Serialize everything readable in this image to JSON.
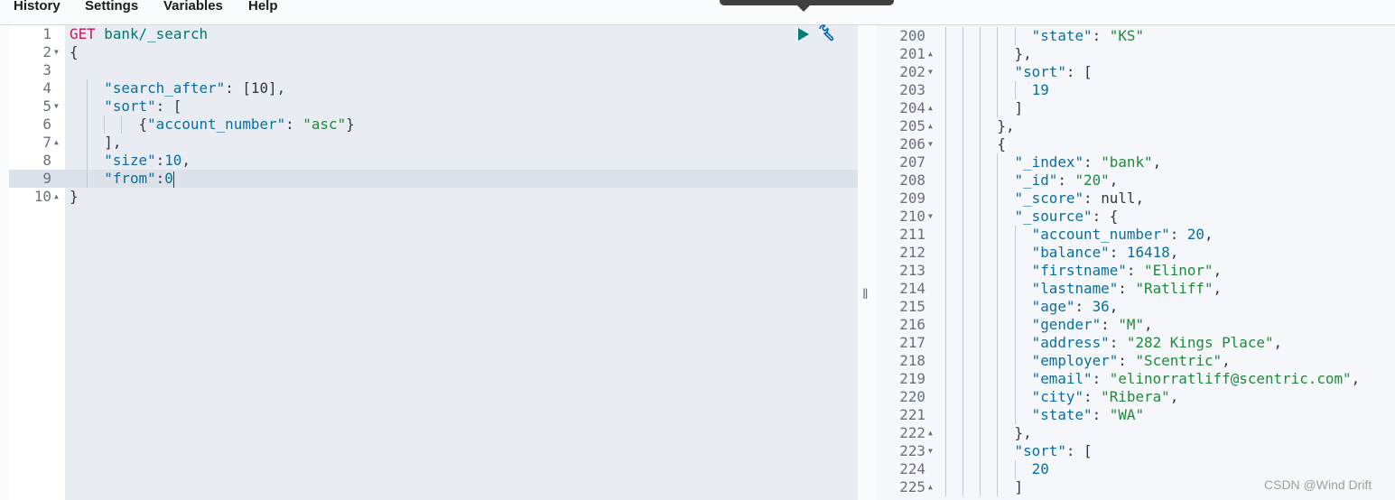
{
  "menu": {
    "items": [
      "History",
      "Settings",
      "Variables",
      "Help"
    ]
  },
  "colors": {
    "method": "#c2185b",
    "url": "#00766c",
    "key": "#0b6ea0",
    "string": "#1f8a3a",
    "run": "#017d73",
    "wrench": "#006bb8"
  },
  "request": {
    "run_icon": "play-icon",
    "settings_icon": "wrench-icon",
    "active_line": 9,
    "lines": [
      {
        "n": "1",
        "fold": "",
        "ind": 0,
        "t": [
          [
            "method",
            "GET"
          ],
          [
            "punc",
            " "
          ],
          [
            "url",
            "bank/_search"
          ]
        ]
      },
      {
        "n": "2",
        "fold": "down",
        "ind": 0,
        "t": [
          [
            "punc",
            "{"
          ]
        ]
      },
      {
        "n": "3",
        "fold": "",
        "ind": 0,
        "t": []
      },
      {
        "n": "4",
        "fold": "",
        "ind": 2,
        "t": [
          [
            "key",
            "\"search_after\""
          ],
          [
            "punc",
            ": [10],"
          ]
        ]
      },
      {
        "n": "5",
        "fold": "down",
        "ind": 2,
        "t": [
          [
            "key",
            "\"sort\""
          ],
          [
            "punc",
            ": ["
          ]
        ]
      },
      {
        "n": "6",
        "fold": "",
        "ind": 4,
        "t": [
          [
            "punc",
            "{"
          ],
          [
            "key",
            "\"account_number\""
          ],
          [
            "punc",
            ": "
          ],
          [
            "str",
            "\"asc\""
          ],
          [
            "punc",
            "}"
          ]
        ]
      },
      {
        "n": "7",
        "fold": "up",
        "ind": 2,
        "t": [
          [
            "punc",
            "],"
          ]
        ]
      },
      {
        "n": "8",
        "fold": "",
        "ind": 2,
        "t": [
          [
            "key",
            "\"size\""
          ],
          [
            "punc",
            ":"
          ],
          [
            "num",
            "10"
          ],
          [
            "punc",
            ","
          ]
        ]
      },
      {
        "n": "9",
        "fold": "",
        "ind": 2,
        "t": [
          [
            "key",
            "\"from\""
          ],
          [
            "punc",
            ":"
          ],
          [
            "num",
            "0"
          ]
        ]
      },
      {
        "n": "10",
        "fold": "up",
        "ind": 0,
        "t": [
          [
            "punc",
            "}"
          ]
        ]
      }
    ]
  },
  "response": {
    "lines": [
      {
        "n": "200",
        "fold": "",
        "ind": 5,
        "t": [
          [
            "key",
            "\"state\""
          ],
          [
            "punc",
            ": "
          ],
          [
            "str",
            "\"KS\""
          ]
        ]
      },
      {
        "n": "201",
        "fold": "up",
        "ind": 4,
        "t": [
          [
            "punc",
            "},"
          ]
        ]
      },
      {
        "n": "202",
        "fold": "down",
        "ind": 4,
        "t": [
          [
            "key",
            "\"sort\""
          ],
          [
            "punc",
            ": ["
          ]
        ]
      },
      {
        "n": "203",
        "fold": "",
        "ind": 5,
        "t": [
          [
            "num",
            "19"
          ]
        ]
      },
      {
        "n": "204",
        "fold": "up",
        "ind": 4,
        "t": [
          [
            "punc",
            "]"
          ]
        ]
      },
      {
        "n": "205",
        "fold": "up",
        "ind": 3,
        "t": [
          [
            "punc",
            "},"
          ]
        ]
      },
      {
        "n": "206",
        "fold": "down",
        "ind": 3,
        "t": [
          [
            "punc",
            "{"
          ]
        ]
      },
      {
        "n": "207",
        "fold": "",
        "ind": 4,
        "t": [
          [
            "key",
            "\"_index\""
          ],
          [
            "punc",
            ": "
          ],
          [
            "str",
            "\"bank\""
          ],
          [
            "punc",
            ","
          ]
        ]
      },
      {
        "n": "208",
        "fold": "",
        "ind": 4,
        "t": [
          [
            "key",
            "\"_id\""
          ],
          [
            "punc",
            ": "
          ],
          [
            "str",
            "\"20\""
          ],
          [
            "punc",
            ","
          ]
        ]
      },
      {
        "n": "209",
        "fold": "",
        "ind": 4,
        "t": [
          [
            "key",
            "\"_score\""
          ],
          [
            "punc",
            ": "
          ],
          [
            "null",
            "null"
          ],
          [
            "punc",
            ","
          ]
        ]
      },
      {
        "n": "210",
        "fold": "down",
        "ind": 4,
        "t": [
          [
            "key",
            "\"_source\""
          ],
          [
            "punc",
            ": {"
          ]
        ]
      },
      {
        "n": "211",
        "fold": "",
        "ind": 5,
        "t": [
          [
            "key",
            "\"account_number\""
          ],
          [
            "punc",
            ": "
          ],
          [
            "num",
            "20"
          ],
          [
            "punc",
            ","
          ]
        ]
      },
      {
        "n": "212",
        "fold": "",
        "ind": 5,
        "t": [
          [
            "key",
            "\"balance\""
          ],
          [
            "punc",
            ": "
          ],
          [
            "num",
            "16418"
          ],
          [
            "punc",
            ","
          ]
        ]
      },
      {
        "n": "213",
        "fold": "",
        "ind": 5,
        "t": [
          [
            "key",
            "\"firstname\""
          ],
          [
            "punc",
            ": "
          ],
          [
            "str",
            "\"Elinor\""
          ],
          [
            "punc",
            ","
          ]
        ]
      },
      {
        "n": "214",
        "fold": "",
        "ind": 5,
        "t": [
          [
            "key",
            "\"lastname\""
          ],
          [
            "punc",
            ": "
          ],
          [
            "str",
            "\"Ratliff\""
          ],
          [
            "punc",
            ","
          ]
        ]
      },
      {
        "n": "215",
        "fold": "",
        "ind": 5,
        "t": [
          [
            "key",
            "\"age\""
          ],
          [
            "punc",
            ": "
          ],
          [
            "num",
            "36"
          ],
          [
            "punc",
            ","
          ]
        ]
      },
      {
        "n": "216",
        "fold": "",
        "ind": 5,
        "t": [
          [
            "key",
            "\"gender\""
          ],
          [
            "punc",
            ": "
          ],
          [
            "str",
            "\"M\""
          ],
          [
            "punc",
            ","
          ]
        ]
      },
      {
        "n": "217",
        "fold": "",
        "ind": 5,
        "t": [
          [
            "key",
            "\"address\""
          ],
          [
            "punc",
            ": "
          ],
          [
            "str",
            "\"282 Kings Place\""
          ],
          [
            "punc",
            ","
          ]
        ]
      },
      {
        "n": "218",
        "fold": "",
        "ind": 5,
        "t": [
          [
            "key",
            "\"employer\""
          ],
          [
            "punc",
            ": "
          ],
          [
            "str",
            "\"Scentric\""
          ],
          [
            "punc",
            ","
          ]
        ]
      },
      {
        "n": "219",
        "fold": "",
        "ind": 5,
        "t": [
          [
            "key",
            "\"email\""
          ],
          [
            "punc",
            ": "
          ],
          [
            "str",
            "\"elinorratliff@scentric.com\""
          ],
          [
            "punc",
            ","
          ]
        ]
      },
      {
        "n": "220",
        "fold": "",
        "ind": 5,
        "t": [
          [
            "key",
            "\"city\""
          ],
          [
            "punc",
            ": "
          ],
          [
            "str",
            "\"Ribera\""
          ],
          [
            "punc",
            ","
          ]
        ]
      },
      {
        "n": "221",
        "fold": "",
        "ind": 5,
        "t": [
          [
            "key",
            "\"state\""
          ],
          [
            "punc",
            ": "
          ],
          [
            "str",
            "\"WA\""
          ]
        ]
      },
      {
        "n": "222",
        "fold": "up",
        "ind": 4,
        "t": [
          [
            "punc",
            "},"
          ]
        ]
      },
      {
        "n": "223",
        "fold": "down",
        "ind": 4,
        "t": [
          [
            "key",
            "\"sort\""
          ],
          [
            "punc",
            ": ["
          ]
        ]
      },
      {
        "n": "224",
        "fold": "",
        "ind": 5,
        "t": [
          [
            "num",
            "20"
          ]
        ]
      },
      {
        "n": "225",
        "fold": "up",
        "ind": 4,
        "t": [
          [
            "punc",
            "]"
          ]
        ]
      }
    ]
  },
  "watermark": "CSDN @Wind Drift"
}
